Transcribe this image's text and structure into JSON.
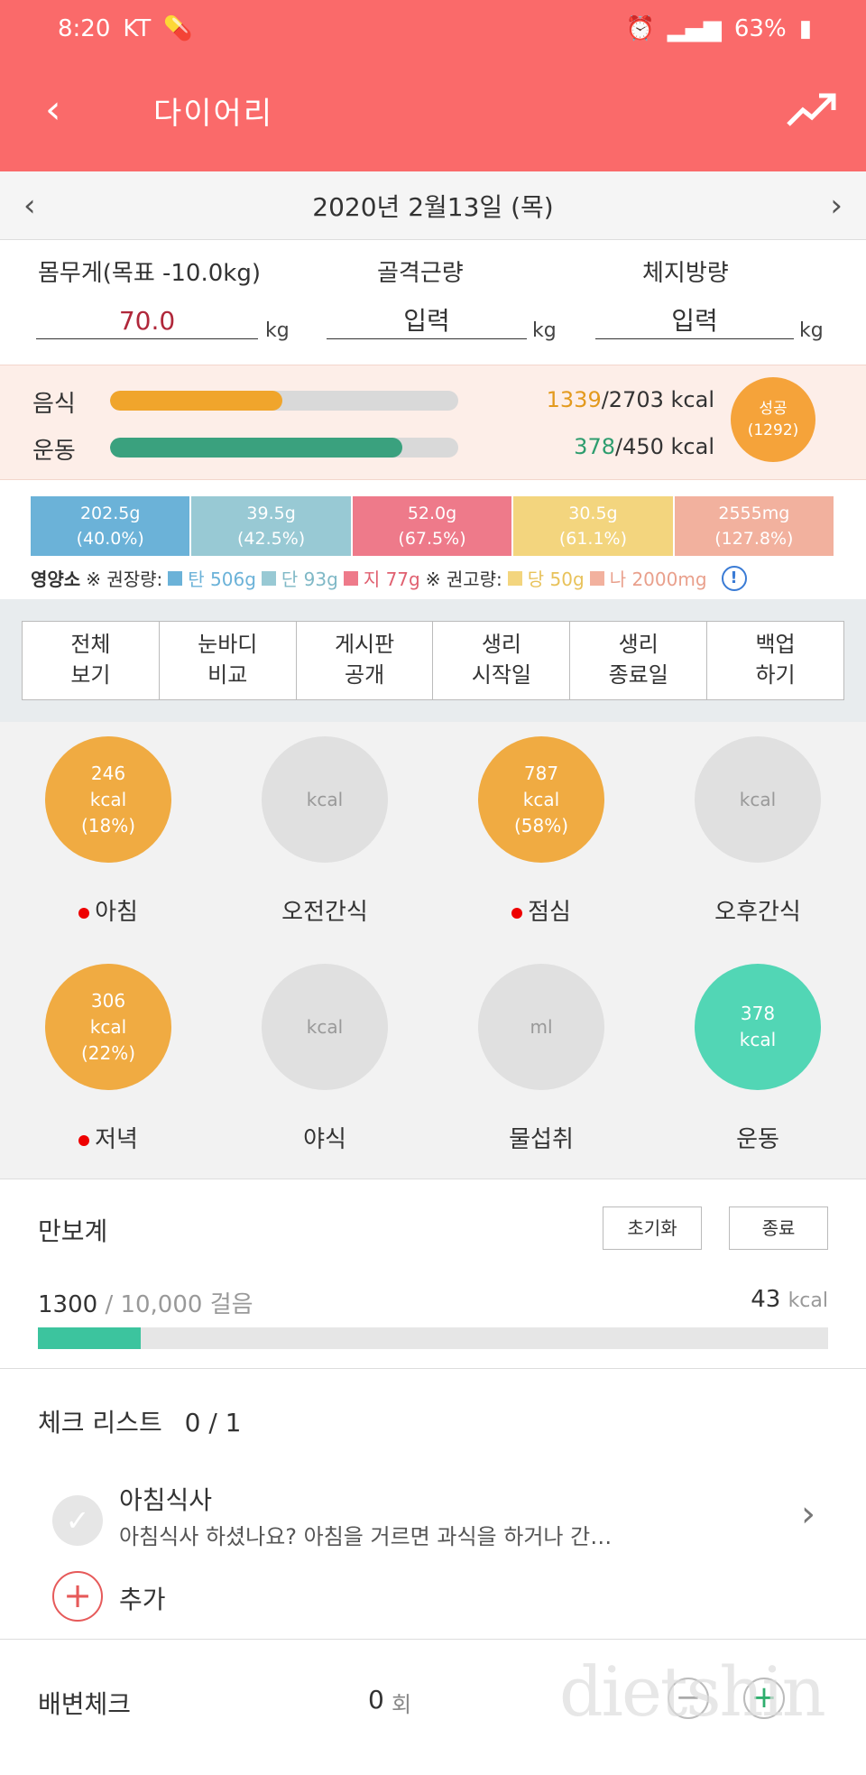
{
  "status": {
    "time": "8:20",
    "carrier": "KT",
    "battery": "63%"
  },
  "app": {
    "title": "다이어리"
  },
  "date": {
    "label": "2020년 2월13일 (목)"
  },
  "weight": {
    "weight_label": "몸무게(목표 -10.0kg)",
    "weight_value": "70.0",
    "unit": "kg",
    "muscle_label": "골격근량",
    "muscle_value": "입력",
    "fat_label": "체지방량",
    "fat_value": "입력"
  },
  "energy": {
    "food_label": "음식",
    "food_eaten": "1339",
    "food_total": "/2703",
    "food_unit": "kcal",
    "food_fraction": 0.4954,
    "exercise_label": "운동",
    "exercise_done": "378",
    "exercise_total": "/450",
    "exercise_unit": "kcal",
    "exercise_fraction": 0.84,
    "success_label": "성공",
    "success_value": "(1292)"
  },
  "nutrients": {
    "bars": [
      {
        "amount": "202.5g",
        "pct": "(40.0%)",
        "color": "#6bb2d8"
      },
      {
        "amount": "39.5g",
        "pct": "(42.5%)",
        "color": "#98c9d4"
      },
      {
        "amount": "52.0g",
        "pct": "(67.5%)",
        "color": "#ee7a8a"
      },
      {
        "amount": "30.5g",
        "pct": "(61.1%)",
        "color": "#f3d57e"
      },
      {
        "amount": "2555mg",
        "pct": "(127.8%)",
        "color": "#f2b19e"
      }
    ],
    "legend_title": "영양소",
    "rec_label": "※ 권장량:",
    "carb": "탄 506g",
    "protein": "단 93g",
    "fat": "지 77g",
    "limit_label": "※ 권고량:",
    "sugar": "당 50g",
    "sodium": "나 2000mg",
    "info": "!"
  },
  "menu": [
    {
      "line1": "전체",
      "line2": "보기"
    },
    {
      "line1": "눈바디",
      "line2": "비교"
    },
    {
      "line1": "게시판",
      "line2": "공개"
    },
    {
      "line1": "생리",
      "line2": "시작일"
    },
    {
      "line1": "생리",
      "line2": "종료일"
    },
    {
      "line1": "백업",
      "line2": "하기"
    }
  ],
  "meals": [
    {
      "kcal": "246",
      "unit": "kcal",
      "pct": "(18%)",
      "label": "아침"
    },
    {
      "kcal": "",
      "unit": "kcal",
      "pct": "",
      "label": "오전간식"
    },
    {
      "kcal": "787",
      "unit": "kcal",
      "pct": "(58%)",
      "label": "점심"
    },
    {
      "kcal": "",
      "unit": "kcal",
      "pct": "",
      "label": "오후간식"
    },
    {
      "kcal": "306",
      "unit": "kcal",
      "pct": "(22%)",
      "label": "저녁"
    },
    {
      "kcal": "",
      "unit": "kcal",
      "pct": "",
      "label": "야식"
    },
    {
      "kcal": "",
      "unit": "ml",
      "pct": "",
      "label": "물섭취"
    },
    {
      "kcal": "378",
      "unit": "kcal",
      "pct": "",
      "label": "운동"
    }
  ],
  "pedometer": {
    "title": "만보계",
    "reset": "초기화",
    "stop": "종료",
    "steps": "1300",
    "goal": "/ 10,000",
    "steps_unit": "걸음",
    "kcal": "43",
    "kcal_unit": "kcal",
    "fraction": 0.13
  },
  "checklist": {
    "title": "체크 리스트",
    "count": "0 / 1",
    "item_title": "아침식사",
    "item_desc": "아침식사 하셨나요? 아침을 거르면 과식을 하거나 간…",
    "add": "추가"
  },
  "bowel": {
    "title": "배변체크",
    "count": "0",
    "unit": "회"
  },
  "watermark": "dietshin"
}
